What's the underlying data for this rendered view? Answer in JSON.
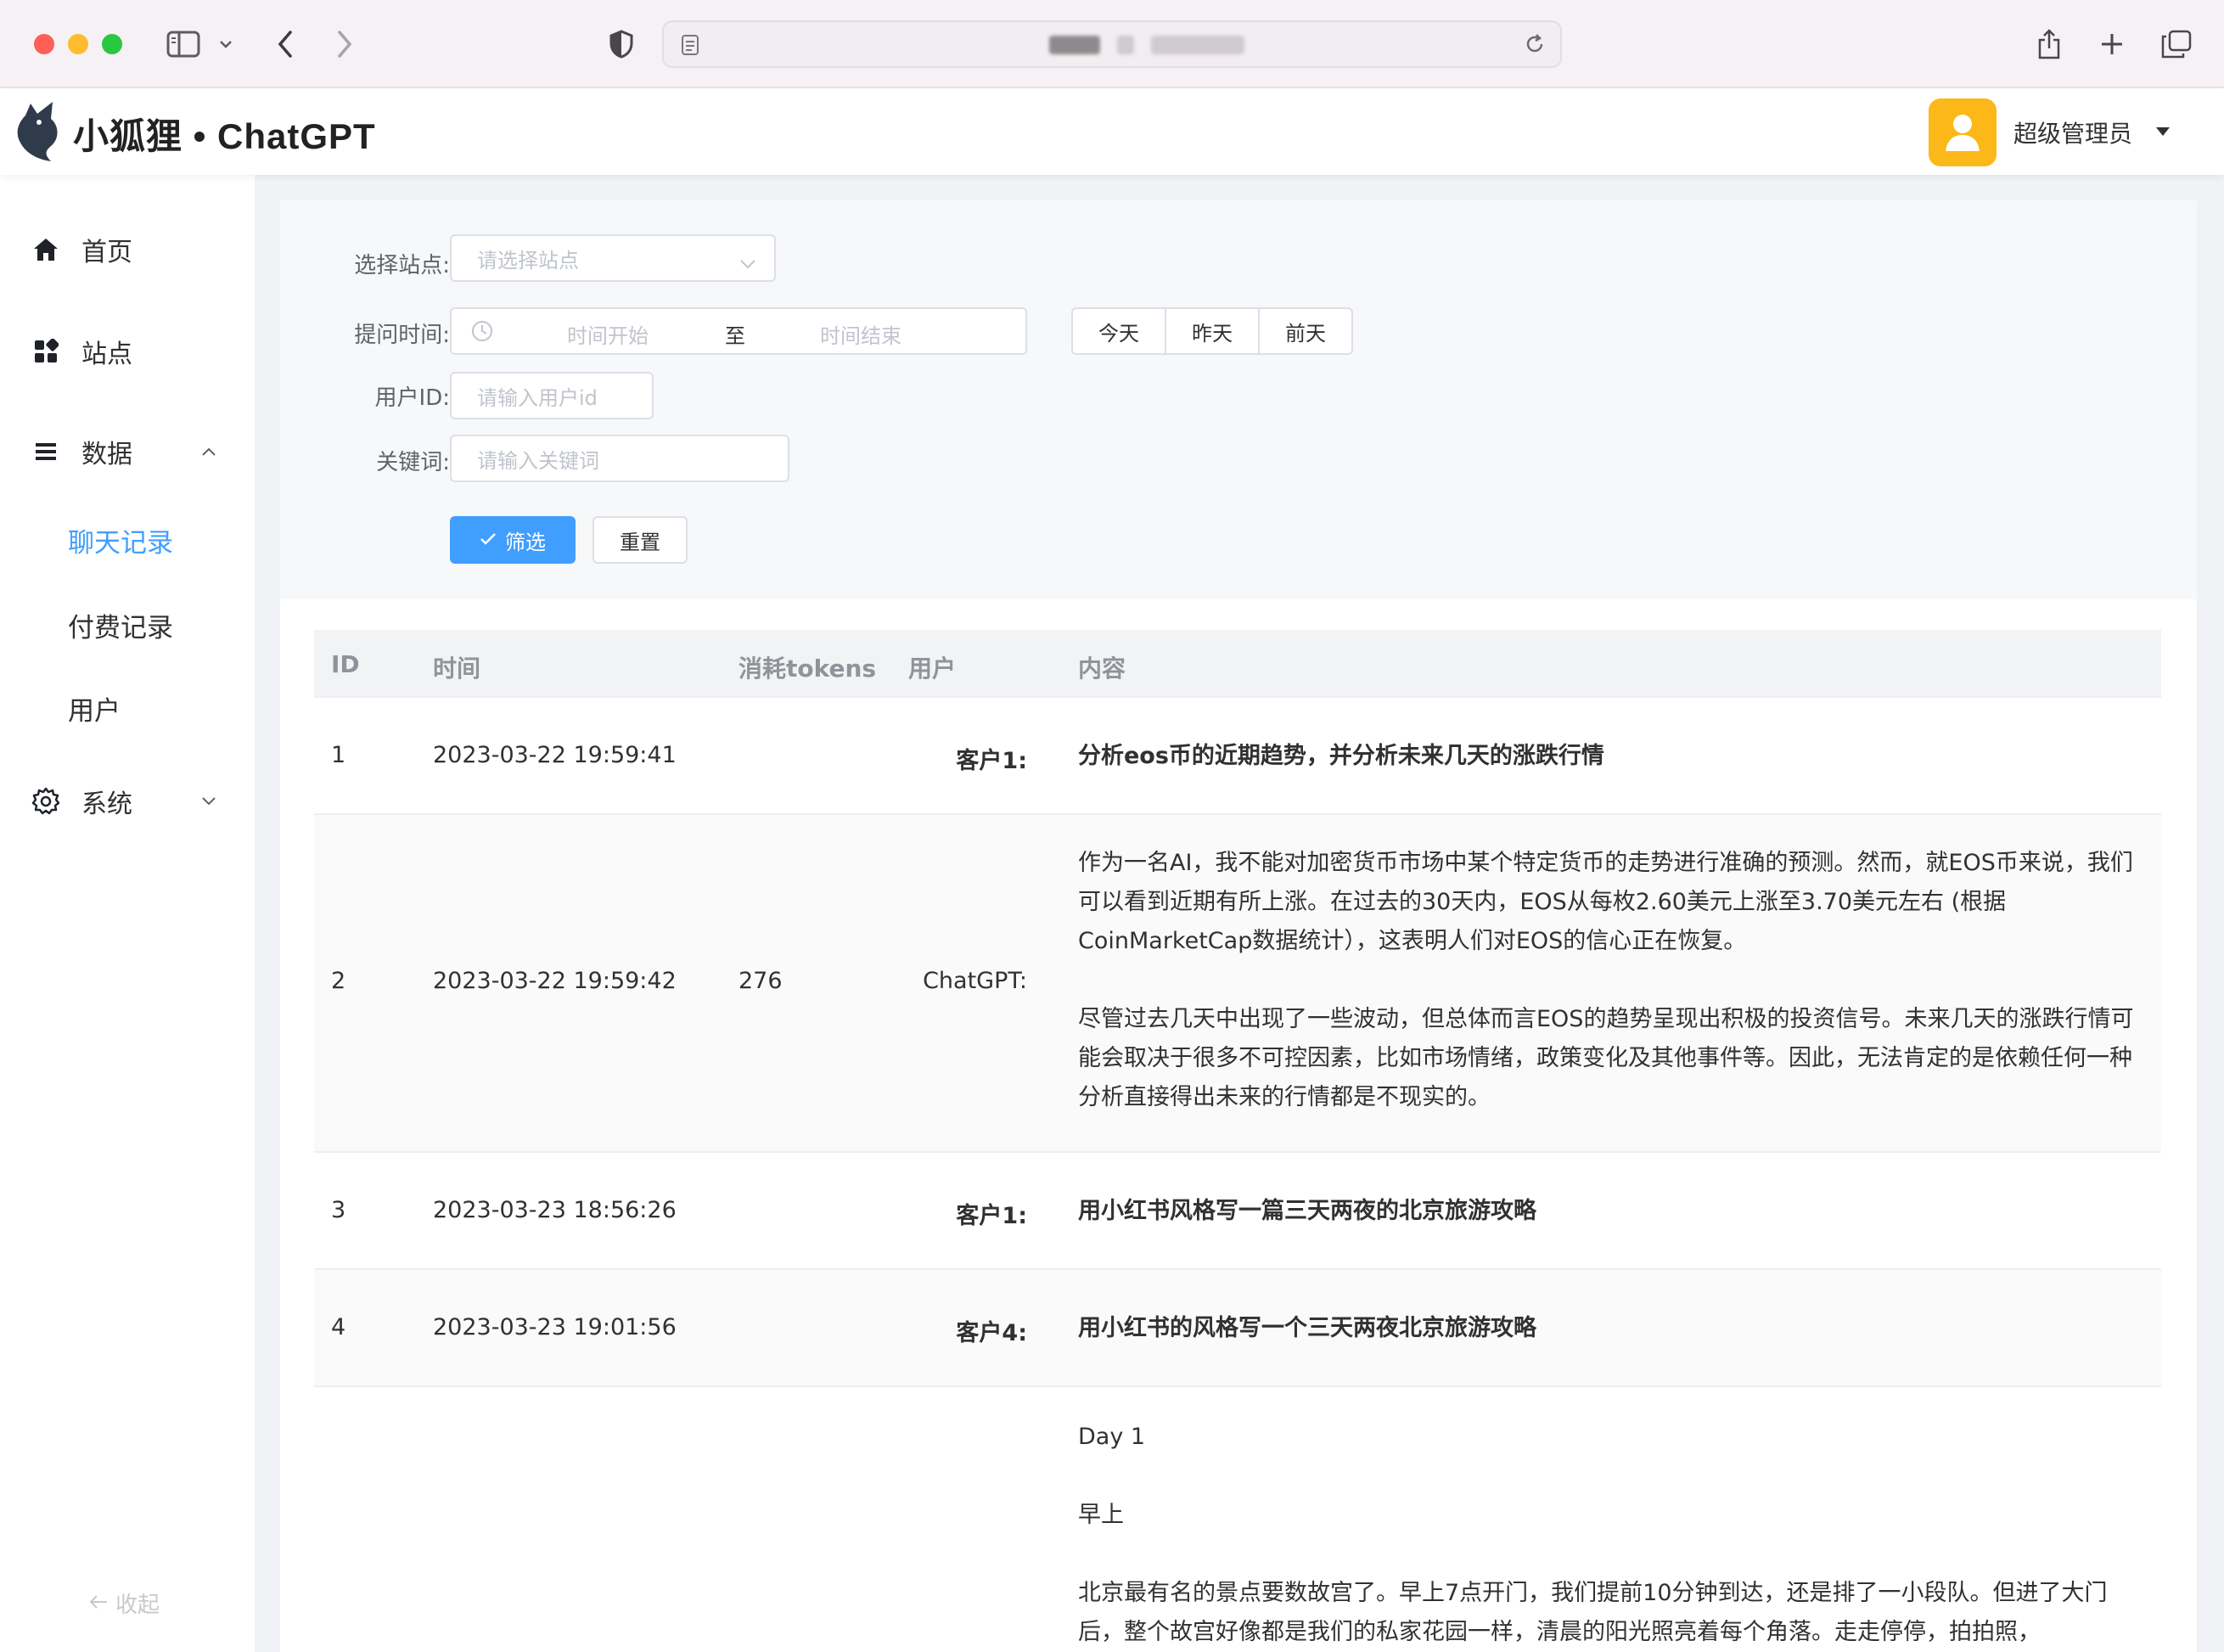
{
  "header": {
    "logo_text": "小狐狸 • ChatGPT",
    "user_name": "超级管理员"
  },
  "sidebar": {
    "items": [
      {
        "label": "首页",
        "icon": "home-icon"
      },
      {
        "label": "站点",
        "icon": "grid-icon"
      },
      {
        "label": "数据",
        "icon": "list-icon"
      },
      {
        "label": "系统",
        "icon": "gear-icon"
      }
    ],
    "sub_items": [
      {
        "label": "聊天记录",
        "active": true
      },
      {
        "label": "付费记录",
        "active": false
      },
      {
        "label": "用户",
        "active": false
      }
    ],
    "collapse_label": "收起"
  },
  "filters": {
    "site_label": "选择站点:",
    "site_placeholder": "请选择站点",
    "time_label": "提问时间:",
    "time_start": "时间开始",
    "time_sep": "至",
    "time_end": "时间结束",
    "quick_dates": [
      "今天",
      "昨天",
      "前天"
    ],
    "userid_label": "用户ID:",
    "userid_placeholder": "请输入用户id",
    "keyword_label": "关键词:",
    "keyword_placeholder": "请输入关键词",
    "submit_label": "筛选",
    "reset_label": "重置"
  },
  "table": {
    "columns": [
      "ID",
      "时间",
      "消耗tokens",
      "用户",
      "内容"
    ],
    "rows": [
      {
        "id": "1",
        "time": "2023-03-22 19:59:41",
        "tokens": "",
        "user": "客户1:",
        "content": [
          "分析eos币的近期趋势，并分析未来几天的涨跌行情"
        ]
      },
      {
        "id": "2",
        "time": "2023-03-22 19:59:42",
        "tokens": "276",
        "user": "ChatGPT:",
        "content": [
          "作为一名AI，我不能对加密货币市场中某个特定货币的走势进行准确的预测。然而，就EOS币来说，我们可以看到近期有所上涨。在过去的30天内，EOS从每枚2.60美元上涨至3.70美元左右 (根据CoinMarketCap数据统计），这表明人们对EOS的信心正在恢复。",
          "尽管过去几天中出现了一些波动，但总体而言EOS的趋势呈现出积极的投资信号。未来几天的涨跌行情可能会取决于很多不可控因素，比如市场情绪，政策变化及其他事件等。因此，无法肯定的是依赖任何一种分析直接得出未来的行情都是不现实的。"
        ]
      },
      {
        "id": "3",
        "time": "2023-03-23 18:56:26",
        "tokens": "",
        "user": "客户1:",
        "content": [
          "用小红书风格写一篇三天两夜的北京旅游攻略"
        ]
      },
      {
        "id": "4",
        "time": "2023-03-23 19:01:56",
        "tokens": "",
        "user": "客户4:",
        "content": [
          "用小红书的风格写一个三天两夜北京旅游攻略"
        ]
      },
      {
        "id": "",
        "time": "",
        "tokens": "",
        "user": "",
        "content": [
          "Day 1",
          "早上",
          "北京最有名的景点要数故宫了。早上7点开门，我们提前10分钟到达，还是排了一小段队。但进了大门后，整个故宫好像都是我们的私家花园一样，清晨的阳光照亮着每个角落。走走停停，拍拍照，"
        ]
      }
    ]
  }
}
